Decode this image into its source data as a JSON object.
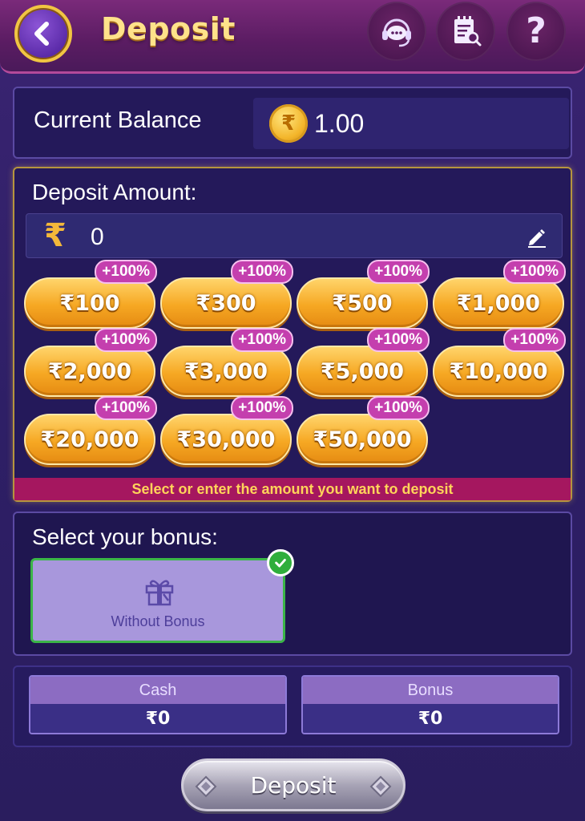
{
  "header": {
    "title": "Deposit",
    "icons": [
      "back-arrow-icon",
      "support-headset-icon",
      "record-search-icon",
      "help-question-icon"
    ],
    "help_glyph": "?"
  },
  "balance": {
    "label": "Current Balance",
    "value": "1.00",
    "coin_glyph": "₹"
  },
  "amount": {
    "title": "Deposit Amount:",
    "currency": "₹",
    "value": "0",
    "hint": "Select or enter the amount you want to deposit",
    "chips": [
      {
        "label": "₹100",
        "badge": "+100%"
      },
      {
        "label": "₹300",
        "badge": "+100%"
      },
      {
        "label": "₹500",
        "badge": "+100%"
      },
      {
        "label": "₹1,000",
        "badge": "+100%"
      },
      {
        "label": "₹2,000",
        "badge": "+100%"
      },
      {
        "label": "₹3,000",
        "badge": "+100%"
      },
      {
        "label": "₹5,000",
        "badge": "+100%"
      },
      {
        "label": "₹10,000",
        "badge": "+100%"
      },
      {
        "label": "₹20,000",
        "badge": "+100%"
      },
      {
        "label": "₹30,000",
        "badge": "+100%"
      },
      {
        "label": "₹50,000",
        "badge": "+100%"
      }
    ]
  },
  "bonus": {
    "title": "Select your bonus:",
    "option_label": "Without Bonus",
    "selected": true
  },
  "summary": {
    "cash_label": "Cash",
    "cash_value": "₹0",
    "bonus_label": "Bonus",
    "bonus_value": "₹0"
  },
  "deposit_button": "Deposit",
  "colors": {
    "accent_gold": "#f6a823",
    "title_gold": "#ffe28a",
    "background": "#2e1f66",
    "hint_bar": "#a5175f",
    "selected_green": "#2fae3c"
  }
}
